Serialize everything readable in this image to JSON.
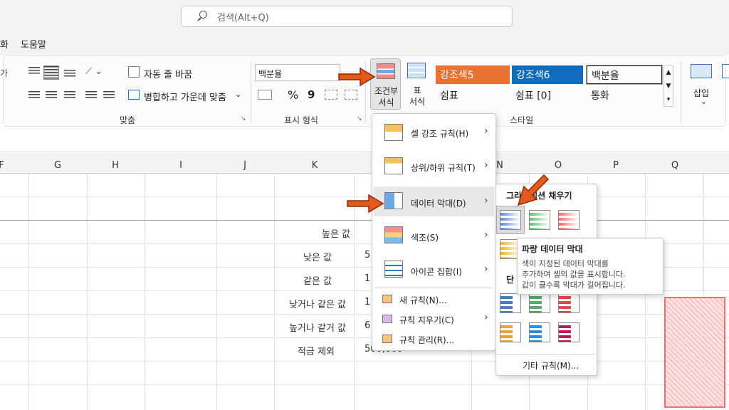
{
  "search": {
    "placeholder": "검색(Alt+Q)"
  },
  "menu_tabs": [
    "화",
    "도움말"
  ],
  "ribbon": {
    "wrap_text": "자동 줄 바꿈",
    "merge_center": "병합하고 가운데 맞춤",
    "align_group": "맞춤",
    "number_format_value": "백분율",
    "number_group": "표시 형식",
    "conditional_format": [
      "조건부",
      "서식"
    ],
    "format_table": [
      "표",
      "서식"
    ],
    "styles_group": "스타일",
    "styles": [
      {
        "label": "강조색5",
        "color": "#e97132"
      },
      {
        "label": "강조색6",
        "color": "#0f6cbd"
      },
      {
        "label": "백분율",
        "color": "#ffffff"
      },
      {
        "label": "쉼표",
        "color": ""
      },
      {
        "label": "쉼표 [0]",
        "color": ""
      },
      {
        "label": "통화",
        "color": ""
      }
    ],
    "insert": "삽입",
    "percent_symbol": "%",
    "comma_symbol": "9"
  },
  "columns": [
    "F",
    "G",
    "H",
    "I",
    "J",
    "K",
    "N",
    "O",
    "P",
    "Q"
  ],
  "rows": [
    {
      "label": "높은 값",
      "value": ""
    },
    {
      "label": "낮은 값",
      "value": "5"
    },
    {
      "label": "같은 값",
      "value": "1"
    },
    {
      "label": "낮거나 같은 값",
      "value": "1"
    },
    {
      "label": "높거나 같거 값",
      "value": "6"
    },
    {
      "label": "적금 제외",
      "value": "500,000"
    }
  ],
  "cf_menu": {
    "items": [
      {
        "label": "셀 강조 규칙(H)"
      },
      {
        "label": "상위/하위 규칙(T)"
      },
      {
        "label": "데이터 막대(D)"
      },
      {
        "label": "색조(S)"
      },
      {
        "label": "아이콘 집합(I)"
      }
    ],
    "small_items": [
      {
        "label": "새 규칙(N)..."
      },
      {
        "label": "규칙 지우기(C)"
      },
      {
        "label": "규칙 관리(R)..."
      }
    ]
  },
  "databar_menu": {
    "gradient_header": "그라데이션 채우기",
    "solid_header": "단",
    "more_rules": "기타 규칙(M)..."
  },
  "tooltip": {
    "title": "파랑 데이터 막대",
    "lines": [
      "색이 지정된 데이터 막대를",
      "추가하여 셀의 값을 표시합니다.",
      "값이 클수록 막대가 길어집니다."
    ]
  },
  "colors": {
    "accent_orange": "#e45a1c",
    "bar_blue": "#5b8bd6",
    "bar_green": "#63be7b",
    "bar_red": "#f8696b"
  }
}
